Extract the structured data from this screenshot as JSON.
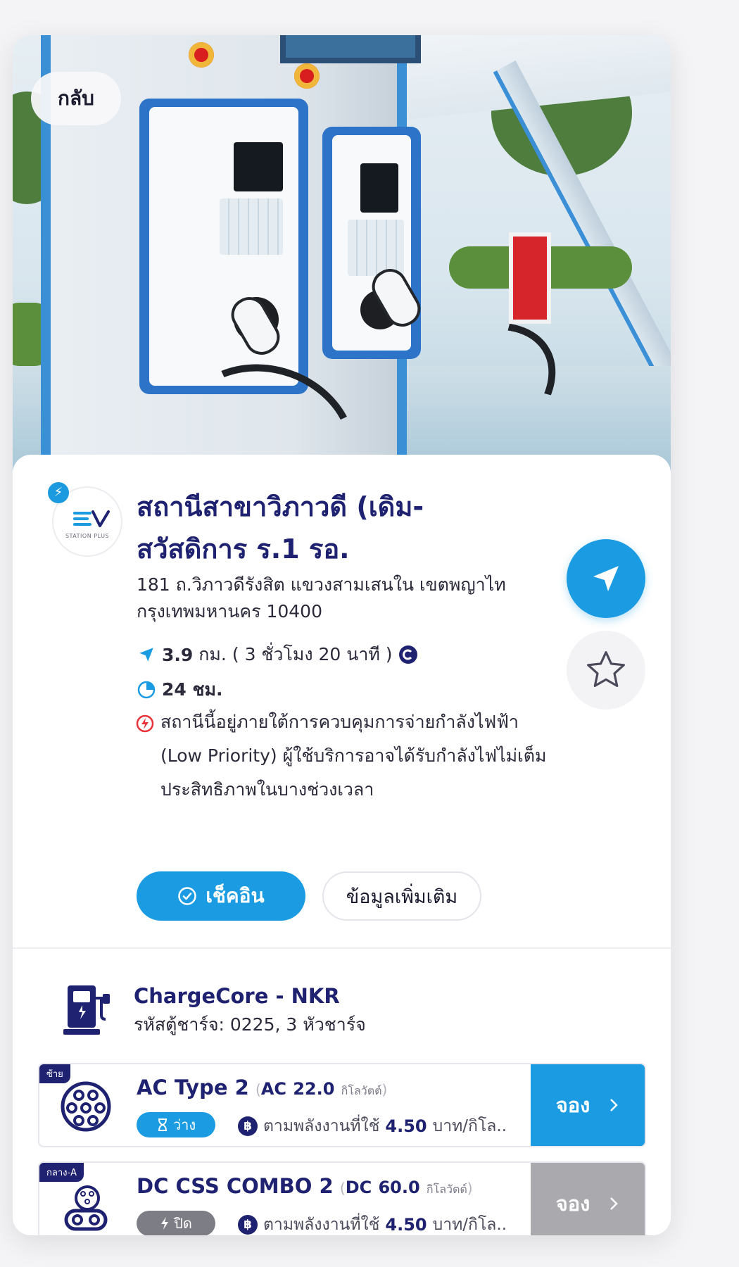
{
  "back_label": "กลับ",
  "station": {
    "logo_text": "STATION PLUS",
    "name": "สถานีสาขาวิภาวดี (เดิม-สวัสดิการ ร.1 รอ.",
    "address": "181 ถ.วิภาวดีรังสิต แขวงสามเสนใน เขตพญาไท กรุงเทพมหานคร 10400",
    "distance": "3.9",
    "distance_unit": "กม.",
    "travel_time": "( 3 ชั่วโมง 20 นาที )",
    "hours": "24 ชม.",
    "warning": "สถานีนี้อยู่ภายใต้การควบคุมการจ่ายกำลังไฟฟ้า (Low Priority) ผู้ใช้บริการอาจได้รับกำลังไฟไม่เต็มประสิทธิภาพในบางช่วงเวลา"
  },
  "actions": {
    "checkin_label": "เช็คอิน",
    "more_info_label": "ข้อมูลเพิ่มเติม"
  },
  "charger": {
    "name": "ChargeCore - NKR",
    "code": "รหัสตู้ชาร์จ: 0225, 3 หัวชาร์จ"
  },
  "connectors": [
    {
      "position": "ซ้าย",
      "type": "AC Type 2",
      "current": "AC",
      "power": "22.0",
      "unit": "กิโลวัตต์",
      "status": "ว่าง",
      "status_color": "#1a9be2",
      "price_label": "ตามพลังงานที่ใช้",
      "price_value": "4.50",
      "price_unit": "บาท/กิโล..",
      "book_label": "จอง",
      "book_color": "#1a9be2"
    },
    {
      "position": "กลาง-A",
      "type": "DC CSS COMBO 2",
      "current": "DC",
      "power": "60.0",
      "unit": "กิโลวัตต์",
      "status": "ปิด",
      "status_color": "#7d7d85",
      "price_label": "ตามพลังงานที่ใช้",
      "price_value": "4.50",
      "price_unit": "บาท/กิโล..",
      "book_label": "จอง",
      "book_color": "#a9a9ae"
    }
  ],
  "colors": {
    "primary": "#1a9be2",
    "navy": "#1e2270",
    "disabled": "#a9a9ae"
  }
}
